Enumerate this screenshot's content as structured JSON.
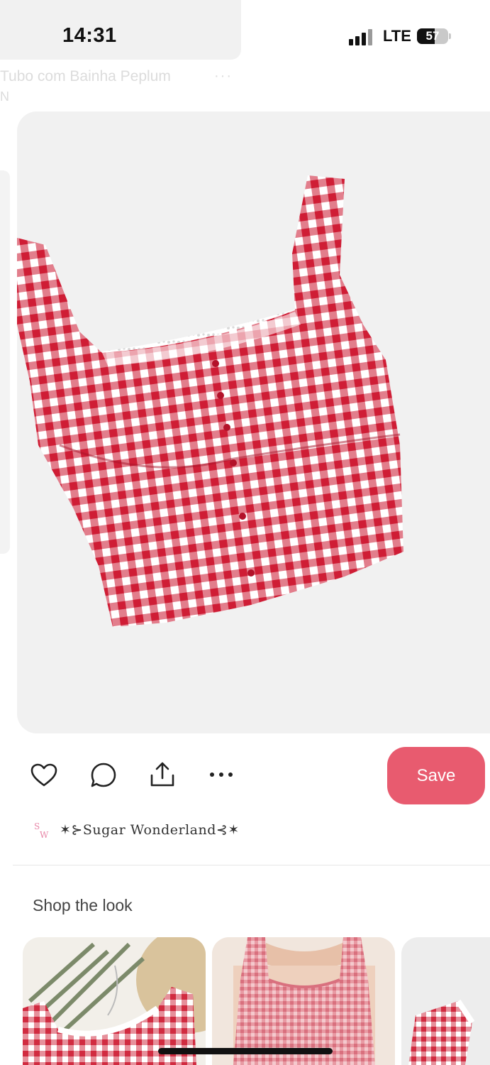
{
  "status_bar": {
    "time": "14:31",
    "network": "LTE",
    "battery": "57"
  },
  "background_card": {
    "title": "Tubo com Bainha Peplum",
    "subtitle": "N"
  },
  "pin": {
    "image_alt": "Red and white gingham crop top with lace trim",
    "actions": {
      "like_icon": "heart-icon",
      "comment_icon": "speech-bubble-icon",
      "share_icon": "share-icon",
      "more_icon": "more-horizontal-icon"
    },
    "save_label": "Save"
  },
  "creator": {
    "name": "✶⊱Sugar Wonderland⊰✶"
  },
  "shop": {
    "title": "Shop the look",
    "items": [
      {
        "alt": "gingham top with palm leaf"
      },
      {
        "alt": "model wearing pink gingham top"
      },
      {
        "alt": "gingham top with lace strap"
      }
    ]
  },
  "colors": {
    "accent": "#e85b6f",
    "gingham": "#d8233a"
  }
}
